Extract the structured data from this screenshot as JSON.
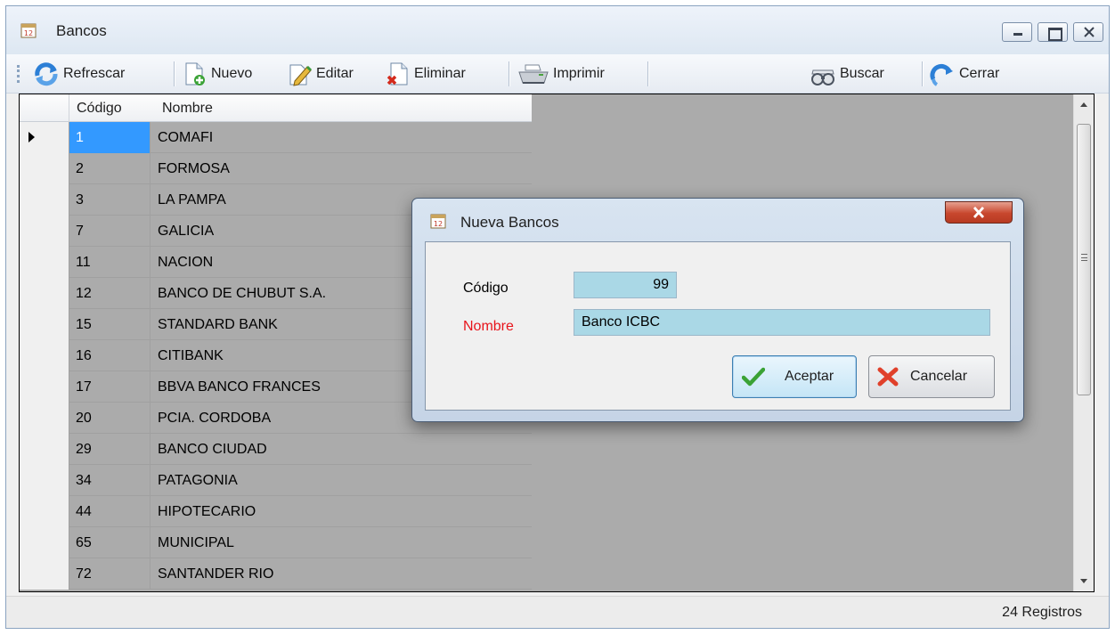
{
  "window": {
    "title": "Bancos"
  },
  "toolbar": {
    "refresh": "Refrescar",
    "new": "Nuevo",
    "edit": "Editar",
    "delete": "Eliminar",
    "print": "Imprimir",
    "search": "Buscar",
    "close": "Cerrar"
  },
  "grid": {
    "columns": {
      "code": "Código",
      "name": "Nombre"
    },
    "rows": [
      {
        "code": "1",
        "name": "COMAFI"
      },
      {
        "code": "2",
        "name": "FORMOSA"
      },
      {
        "code": "3",
        "name": "LA PAMPA"
      },
      {
        "code": "7",
        "name": "GALICIA"
      },
      {
        "code": "11",
        "name": "NACION"
      },
      {
        "code": "12",
        "name": "BANCO DE CHUBUT S.A."
      },
      {
        "code": "15",
        "name": "STANDARD BANK"
      },
      {
        "code": "16",
        "name": "CITIBANK"
      },
      {
        "code": "17",
        "name": "BBVA BANCO FRANCES"
      },
      {
        "code": "20",
        "name": "PCIA. CORDOBA"
      },
      {
        "code": "29",
        "name": "BANCO CIUDAD"
      },
      {
        "code": "34",
        "name": "PATAGONIA"
      },
      {
        "code": "44",
        "name": "HIPOTECARIO"
      },
      {
        "code": "65",
        "name": "MUNICIPAL"
      },
      {
        "code": "72",
        "name": "SANTANDER RIO"
      }
    ]
  },
  "status": {
    "records": "24 Registros"
  },
  "dialog": {
    "title": "Nueva Bancos",
    "code_label": "Código",
    "code_value": "99",
    "name_label": "Nombre",
    "name_value": "Banco ICBC",
    "accept": "Aceptar",
    "cancel": "Cancelar"
  },
  "colors": {
    "selection": "#3399ff",
    "field_background": "#aad8e6",
    "required_label": "#e8141b"
  }
}
